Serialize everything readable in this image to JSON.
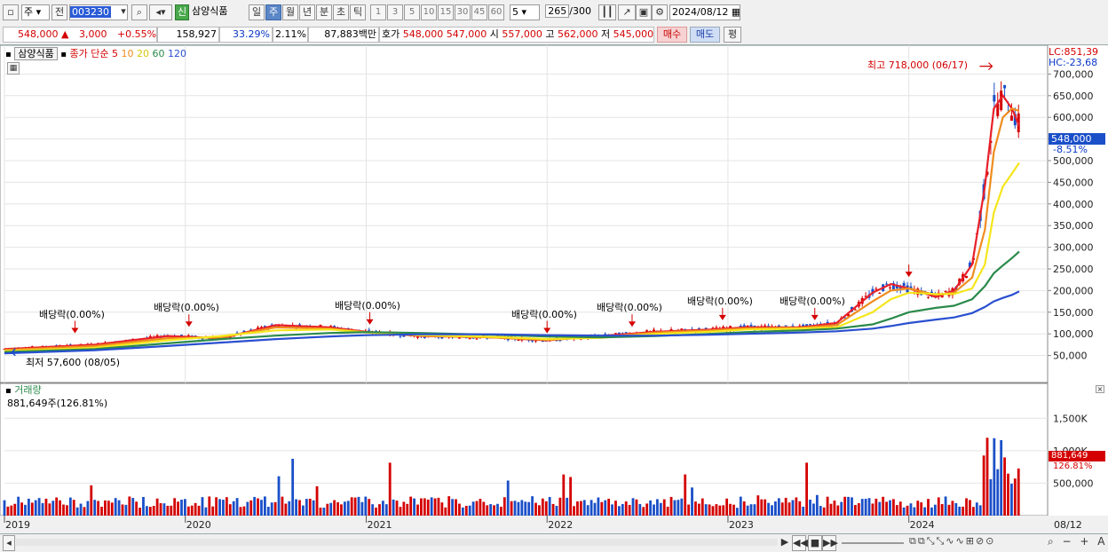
{
  "toolbar": {
    "market": "주",
    "prev": "전",
    "code": "003230",
    "badge": "신",
    "name": "삼양식품",
    "periods": [
      "일",
      "주",
      "월",
      "년",
      "분",
      "초",
      "틱"
    ],
    "period_selected": "주",
    "intervals": [
      "1",
      "3",
      "5",
      "10",
      "15",
      "30",
      "45",
      "60"
    ],
    "interval_value": "5",
    "count": "265",
    "count_max": "/300",
    "date": "2024/08/12"
  },
  "quote": {
    "price": "548,000",
    "change": "3,000",
    "change_pct": "+0.55%",
    "volume": "158,927",
    "ratio1": "33.29%",
    "ratio2": "2.11%",
    "amount": "87,883백만",
    "hoga_label": "호가",
    "ask": "548,000",
    "bid": "547,000",
    "open_label": "시",
    "open": "557,000",
    "high_label": "고",
    "high": "562,000",
    "low_label": "저",
    "low": "545,000",
    "buy": "매수",
    "sell": "매도",
    "eval": "평"
  },
  "legend": {
    "stock": "삼양식품",
    "type": "종가 단순",
    "ma5": "5",
    "ma10": "10",
    "ma20": "20",
    "ma60": "60",
    "ma120": "120",
    "lc": "LC:851,39",
    "hc": "HC:-23,68"
  },
  "annotations": {
    "max": "최고 718,000 (06/17)",
    "min": "최저 57,600 (08/05)",
    "dividends": [
      "배당락(0.00%)",
      "배당락(0.00%)",
      "배당락(0.00%)",
      "배당락(0.00%)",
      "배당락(0.00%)",
      "배당락(0.00%)",
      "배당락(0.00%)"
    ]
  },
  "current": {
    "price": "548,000",
    "pct": "-8.51%"
  },
  "volume_panel": {
    "title": "거래량",
    "value": "881,649주(126.81%)",
    "current": "881,649",
    "pct": "126.81%",
    "ticks": [
      "1,500K",
      "1,000K",
      "500,000"
    ]
  },
  "colors": {
    "up": "#d40000",
    "down": "#1a4fc8",
    "ma5": "#e8202a",
    "ma10": "#f08c1e",
    "ma20": "#f5e61a",
    "ma60": "#2a8a4a",
    "ma120": "#2a4fd0"
  },
  "chart_data": {
    "type": "line",
    "title": "삼양식품",
    "xlabel": "",
    "ylabel": "",
    "x_labels": [
      "2019",
      "2020",
      "2021",
      "2022",
      "2023",
      "2024",
      "08/12"
    ],
    "y_ticks": [
      "700,000",
      "650,000",
      "600,000",
      "550,000",
      "500,000",
      "450,000",
      "400,000",
      "350,000",
      "300,000",
      "250,000",
      "200,000",
      "150,000",
      "100,000",
      "50,000"
    ],
    "ylim": [
      0,
      750000
    ],
    "series": [
      {
        "name": "5",
        "color": "#e8202a",
        "values": [
          [
            2019.0,
            65000
          ],
          [
            2019.5,
            75000
          ],
          [
            2019.9,
            95000
          ],
          [
            2020.2,
            90000
          ],
          [
            2020.5,
            120000
          ],
          [
            2020.8,
            115000
          ],
          [
            2021.0,
            105000
          ],
          [
            2021.3,
            95000
          ],
          [
            2021.7,
            92000
          ],
          [
            2022.0,
            85000
          ],
          [
            2022.3,
            95000
          ],
          [
            2022.6,
            105000
          ],
          [
            2022.9,
            110000
          ],
          [
            2023.1,
            115000
          ],
          [
            2023.4,
            115000
          ],
          [
            2023.6,
            125000
          ],
          [
            2023.8,
            195000
          ],
          [
            2023.9,
            215000
          ],
          [
            2024.0,
            205000
          ],
          [
            2024.15,
            185000
          ],
          [
            2024.25,
            200000
          ],
          [
            2024.35,
            260000
          ],
          [
            2024.42,
            440000
          ],
          [
            2024.47,
            620000
          ],
          [
            2024.52,
            650000
          ],
          [
            2024.57,
            620000
          ],
          [
            2024.61,
            580000
          ]
        ]
      },
      {
        "name": "10",
        "color": "#f08c1e",
        "values": [
          [
            2019.0,
            63000
          ],
          [
            2019.5,
            72000
          ],
          [
            2019.9,
            90000
          ],
          [
            2020.2,
            92000
          ],
          [
            2020.5,
            115000
          ],
          [
            2020.8,
            112000
          ],
          [
            2021.0,
            104000
          ],
          [
            2021.3,
            96000
          ],
          [
            2021.7,
            92000
          ],
          [
            2022.0,
            86000
          ],
          [
            2022.3,
            93000
          ],
          [
            2022.6,
            103000
          ],
          [
            2022.9,
            108000
          ],
          [
            2023.1,
            113000
          ],
          [
            2023.4,
            114000
          ],
          [
            2023.6,
            120000
          ],
          [
            2023.8,
            175000
          ],
          [
            2023.9,
            200000
          ],
          [
            2024.0,
            205000
          ],
          [
            2024.15,
            190000
          ],
          [
            2024.25,
            195000
          ],
          [
            2024.35,
            230000
          ],
          [
            2024.42,
            340000
          ],
          [
            2024.47,
            520000
          ],
          [
            2024.52,
            600000
          ],
          [
            2024.57,
            620000
          ],
          [
            2024.61,
            615000
          ]
        ]
      },
      {
        "name": "20",
        "color": "#f5e61a",
        "values": [
          [
            2019.0,
            60000
          ],
          [
            2019.5,
            68000
          ],
          [
            2019.9,
            85000
          ],
          [
            2020.2,
            95000
          ],
          [
            2020.5,
            108000
          ],
          [
            2020.8,
            110000
          ],
          [
            2021.0,
            103000
          ],
          [
            2021.3,
            97000
          ],
          [
            2021.7,
            93000
          ],
          [
            2022.0,
            88000
          ],
          [
            2022.3,
            91000
          ],
          [
            2022.6,
            100000
          ],
          [
            2022.9,
            105000
          ],
          [
            2023.1,
            110000
          ],
          [
            2023.4,
            112000
          ],
          [
            2023.6,
            115000
          ],
          [
            2023.8,
            150000
          ],
          [
            2023.9,
            180000
          ],
          [
            2024.0,
            195000
          ],
          [
            2024.15,
            192000
          ],
          [
            2024.25,
            192000
          ],
          [
            2024.35,
            205000
          ],
          [
            2024.42,
            260000
          ],
          [
            2024.47,
            380000
          ],
          [
            2024.52,
            440000
          ],
          [
            2024.57,
            470000
          ],
          [
            2024.61,
            495000
          ]
        ]
      },
      {
        "name": "60",
        "color": "#2a8a4a",
        "values": [
          [
            2019.0,
            58000
          ],
          [
            2019.5,
            65000
          ],
          [
            2019.9,
            78000
          ],
          [
            2020.2,
            88000
          ],
          [
            2020.5,
            96000
          ],
          [
            2020.8,
            102000
          ],
          [
            2021.0,
            104000
          ],
          [
            2021.3,
            102000
          ],
          [
            2021.7,
            98000
          ],
          [
            2022.0,
            94000
          ],
          [
            2022.3,
            92000
          ],
          [
            2022.6,
            95000
          ],
          [
            2022.9,
            100000
          ],
          [
            2023.1,
            104000
          ],
          [
            2023.4,
            108000
          ],
          [
            2023.6,
            112000
          ],
          [
            2023.8,
            122000
          ],
          [
            2023.9,
            135000
          ],
          [
            2024.0,
            150000
          ],
          [
            2024.15,
            160000
          ],
          [
            2024.25,
            165000
          ],
          [
            2024.35,
            180000
          ],
          [
            2024.42,
            210000
          ],
          [
            2024.47,
            240000
          ],
          [
            2024.52,
            258000
          ],
          [
            2024.57,
            275000
          ],
          [
            2024.61,
            290000
          ]
        ]
      },
      {
        "name": "120",
        "color": "#2a4fd0",
        "values": [
          [
            2019.0,
            55000
          ],
          [
            2019.5,
            62000
          ],
          [
            2019.9,
            72000
          ],
          [
            2020.2,
            80000
          ],
          [
            2020.5,
            88000
          ],
          [
            2020.8,
            94000
          ],
          [
            2021.0,
            97000
          ],
          [
            2021.3,
            99000
          ],
          [
            2021.7,
            99000
          ],
          [
            2022.0,
            97000
          ],
          [
            2022.3,
            96000
          ],
          [
            2022.6,
            96000
          ],
          [
            2022.9,
            98000
          ],
          [
            2023.1,
            100000
          ],
          [
            2023.4,
            103000
          ],
          [
            2023.6,
            106000
          ],
          [
            2023.8,
            112000
          ],
          [
            2023.9,
            118000
          ],
          [
            2024.0,
            125000
          ],
          [
            2024.15,
            133000
          ],
          [
            2024.25,
            138000
          ],
          [
            2024.35,
            148000
          ],
          [
            2024.42,
            162000
          ],
          [
            2024.47,
            175000
          ],
          [
            2024.52,
            183000
          ],
          [
            2024.57,
            190000
          ],
          [
            2024.61,
            198000
          ]
        ]
      }
    ],
    "dividend_markers": [
      [
        2019.39,
        85000
      ],
      [
        2020.02,
        100000
      ],
      [
        2021.02,
        105000
      ],
      [
        2022.0,
        85000
      ],
      [
        2022.47,
        100000
      ],
      [
        2022.97,
        115000
      ],
      [
        2023.48,
        115000
      ],
      [
        2024.0,
        215000
      ]
    ],
    "high_point": [
      2024.48,
      718000
    ],
    "low_point": [
      2019.07,
      57600
    ]
  }
}
